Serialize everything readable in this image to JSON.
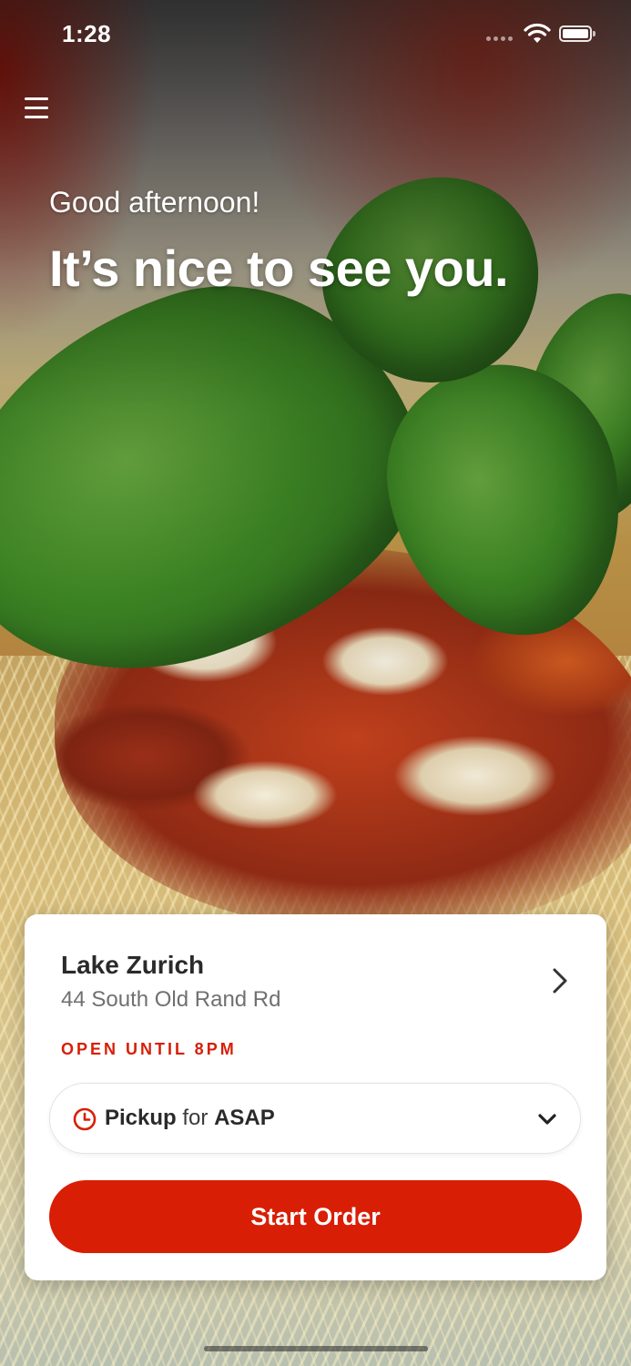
{
  "status_bar": {
    "time": "1:28"
  },
  "greeting": {
    "subtitle": "Good afternoon!",
    "headline": "It’s nice to see you."
  },
  "store": {
    "name": "Lake Zurich",
    "address": "44 South Old Rand Rd",
    "status": "OPEN UNTIL 8PM"
  },
  "order_mode": {
    "mode": "Pickup",
    "connector": "for",
    "time": "ASAP"
  },
  "actions": {
    "start_order": "Start Order"
  },
  "colors": {
    "accent": "#d81e05",
    "card": "#ffffff",
    "text_primary": "#2a2a2a",
    "text_secondary": "#707070"
  },
  "icons": {
    "menu": "hamburger-menu-icon",
    "location_chevron": "chevron-right-icon",
    "clock": "clock-icon",
    "dropdown": "chevron-down-icon"
  }
}
